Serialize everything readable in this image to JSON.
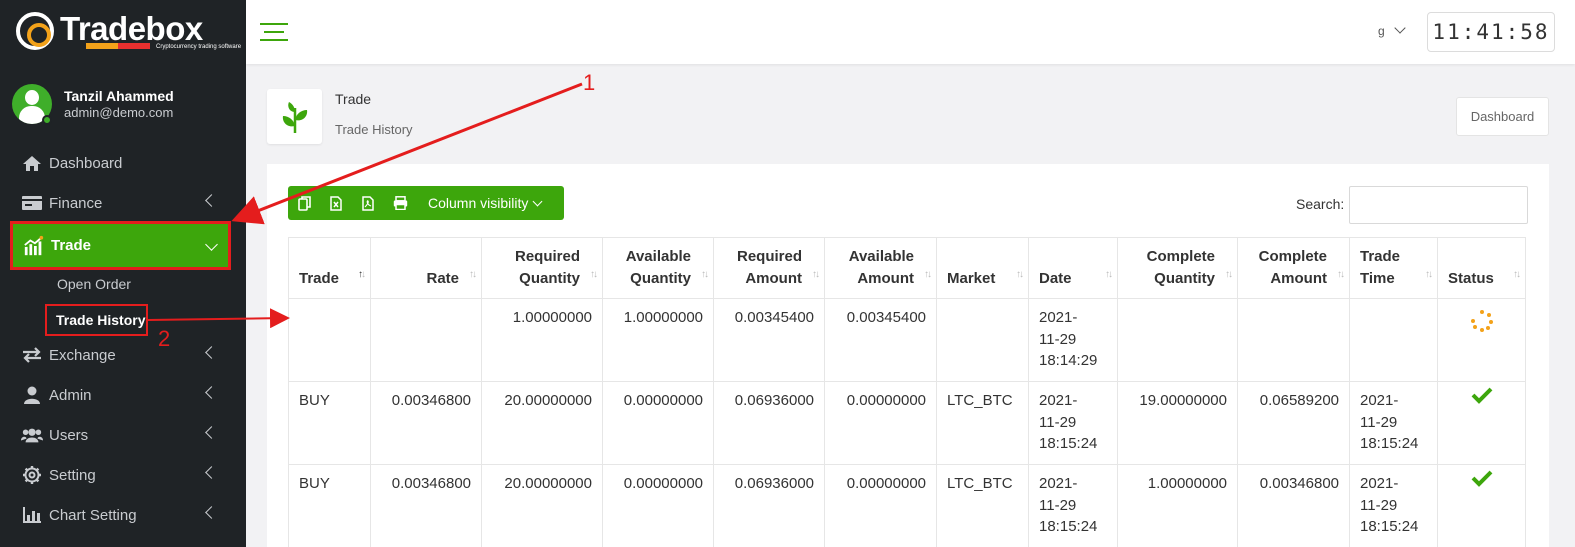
{
  "brand": {
    "name_part1": "Trade",
    "name_part2": "box",
    "tagline": "Cryptocurrency trading software"
  },
  "user": {
    "name": "Tanzil Ahammed",
    "email": "admin@demo.com"
  },
  "sidebar": {
    "items": [
      {
        "label": "Dashboard",
        "icon": "home-icon"
      },
      {
        "label": "Finance",
        "icon": "wallet-icon"
      },
      {
        "label": "Trade",
        "icon": "chart-icon"
      },
      {
        "label": "Exchange",
        "icon": "exchange-icon"
      },
      {
        "label": "Admin",
        "icon": "user-icon"
      },
      {
        "label": "Users",
        "icon": "users-icon"
      },
      {
        "label": "Setting",
        "icon": "gear-icon"
      },
      {
        "label": "Chart Setting",
        "icon": "bar-chart-icon"
      }
    ],
    "trade_sub": [
      {
        "label": "Open Order"
      },
      {
        "label": "Trade History"
      }
    ]
  },
  "header": {
    "lang": "g",
    "clock": "11:41:58"
  },
  "breadcrumb": {
    "title": "Trade",
    "subtitle": "Trade History",
    "dashboard_button": "Dashboard"
  },
  "toolbar": {
    "column_visibility": "Column visibility"
  },
  "search": {
    "label": "Search:"
  },
  "table": {
    "headers": [
      [
        "Trade"
      ],
      [
        "Rate"
      ],
      [
        "Required",
        "Quantity"
      ],
      [
        "Available",
        "Quantity"
      ],
      [
        "Required",
        "Amount"
      ],
      [
        "Available",
        "Amount"
      ],
      [
        "Market"
      ],
      [
        "Date"
      ],
      [
        "Complete",
        "Quantity"
      ],
      [
        "Complete",
        "Amount"
      ],
      [
        "Trade",
        "Time"
      ],
      [
        "Status"
      ]
    ],
    "rows": [
      {
        "trade": "",
        "rate": "",
        "req_qty": "1.00000000",
        "avail_qty": "1.00000000",
        "req_amt": "0.00345400",
        "avail_amt": "0.00345400",
        "market": "",
        "date": [
          "2021-",
          "11-29",
          "18:14:29"
        ],
        "comp_qty": "",
        "comp_amt": "",
        "time": [
          "",
          "",
          ""
        ],
        "status": "pending"
      },
      {
        "trade": "BUY",
        "rate": "0.00346800",
        "req_qty": "20.00000000",
        "avail_qty": "0.00000000",
        "req_amt": "0.06936000",
        "avail_amt": "0.00000000",
        "market": "LTC_BTC",
        "date": [
          "2021-",
          "11-29",
          "18:15:24"
        ],
        "comp_qty": "19.00000000",
        "comp_amt": "0.06589200",
        "time": [
          "2021-",
          "11-29",
          "18:15:24"
        ],
        "status": "complete"
      },
      {
        "trade": "BUY",
        "rate": "0.00346800",
        "req_qty": "20.00000000",
        "avail_qty": "0.00000000",
        "req_amt": "0.06936000",
        "avail_amt": "0.00000000",
        "market": "LTC_BTC",
        "date": [
          "2021-",
          "11-29",
          "18:15:24"
        ],
        "comp_qty": "1.00000000",
        "comp_amt": "0.00346800",
        "time": [
          "2021-",
          "11-29",
          "18:15:24"
        ],
        "status": "complete"
      }
    ]
  },
  "annotations": {
    "one": "1",
    "two": "2"
  },
  "colors": {
    "accent": "#3da60c",
    "highlight": "#e41d1d",
    "sidebar": "#1f2326",
    "spinner": "#f3a21a"
  }
}
